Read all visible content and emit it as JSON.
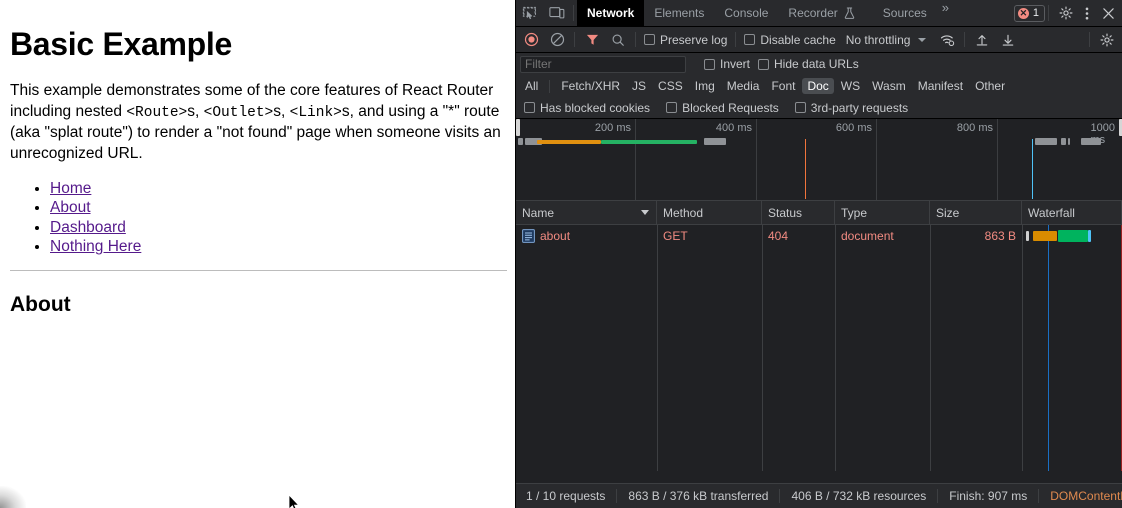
{
  "page": {
    "title": "Basic Example",
    "paragraph_parts": [
      {
        "text": "This example demonstrates some of the core features of React Router including nested ",
        "mono": false
      },
      {
        "text": "<Route>",
        "mono": true
      },
      {
        "text": "s, ",
        "mono": false
      },
      {
        "text": "<Outlet>",
        "mono": true
      },
      {
        "text": "s, ",
        "mono": false
      },
      {
        "text": "<Link>",
        "mono": true
      },
      {
        "text": "s, and using a \"*\" route (aka \"splat route\") to render a \"not found\" page when someone visits an unrecognized URL.",
        "mono": false
      }
    ],
    "nav_links": [
      "Home",
      "About",
      "Dashboard",
      "Nothing Here"
    ],
    "section_heading": "About",
    "link_color": "#551a8b"
  },
  "devtools": {
    "tabbar": {
      "inspect_icon": "inspect-element-icon",
      "device_icon": "device-toolbar-icon",
      "tabs": [
        {
          "label": "Network",
          "active": true
        },
        {
          "label": "Elements",
          "active": false
        },
        {
          "label": "Console",
          "active": false
        },
        {
          "label": "Recorder",
          "active": false
        },
        {
          "label": "Sources",
          "active": false
        }
      ],
      "recorder_flask_icon": "flask-icon",
      "more_tabs": "»",
      "error_count": "1",
      "settings_icon": "gear-icon",
      "more_options_icon": "kebab-menu-icon",
      "close_icon": "close-icon"
    },
    "toolbar": {
      "record_icon": "record-stop-icon",
      "clear_icon": "clear-icon",
      "filter_icon": "filter-icon",
      "search_icon": "search-icon",
      "preserve_log": "Preserve log",
      "disable_cache": "Disable cache",
      "throttling": "No throttling",
      "wifi_icon": "network-conditions-icon",
      "import_icon": "import-har-icon",
      "export_icon": "export-har-icon",
      "capture_settings_icon": "gear-icon"
    },
    "filter_row": {
      "placeholder": "Filter",
      "invert": "Invert",
      "hide_data_urls": "Hide data URLs"
    },
    "type_filters": [
      {
        "label": "All",
        "active": false
      },
      {
        "label": "Fetch/XHR",
        "active": false
      },
      {
        "label": "JS",
        "active": false
      },
      {
        "label": "CSS",
        "active": false
      },
      {
        "label": "Img",
        "active": false
      },
      {
        "label": "Media",
        "active": false
      },
      {
        "label": "Font",
        "active": false
      },
      {
        "label": "Doc",
        "active": true
      },
      {
        "label": "WS",
        "active": false
      },
      {
        "label": "Wasm",
        "active": false
      },
      {
        "label": "Manifest",
        "active": false
      },
      {
        "label": "Other",
        "active": false
      }
    ],
    "option_row": [
      "Has blocked cookies",
      "Blocked Requests",
      "3rd-party requests"
    ],
    "overview": {
      "ticks": [
        "200 ms",
        "400 ms",
        "600 ms",
        "800 ms",
        "1000 ms"
      ],
      "dcl_marker_color": "#4fc3f7",
      "load_marker_color": "#f0743c"
    },
    "table": {
      "columns": [
        "Name",
        "Method",
        "Status",
        "Type",
        "Size",
        "Waterfall"
      ],
      "sorted_column": "Name",
      "rows": [
        {
          "name": "about",
          "method": "GET",
          "status": "404",
          "type": "document",
          "size": "863 B",
          "icon": "document-icon",
          "error": true
        }
      ]
    },
    "statusbar": {
      "requests": "1 / 10 requests",
      "transferred": "863 B / 376 kB transferred",
      "resources": "406 B / 732 kB resources",
      "finish": "Finish: 907 ms",
      "dcl": "DOMContentLo"
    }
  }
}
